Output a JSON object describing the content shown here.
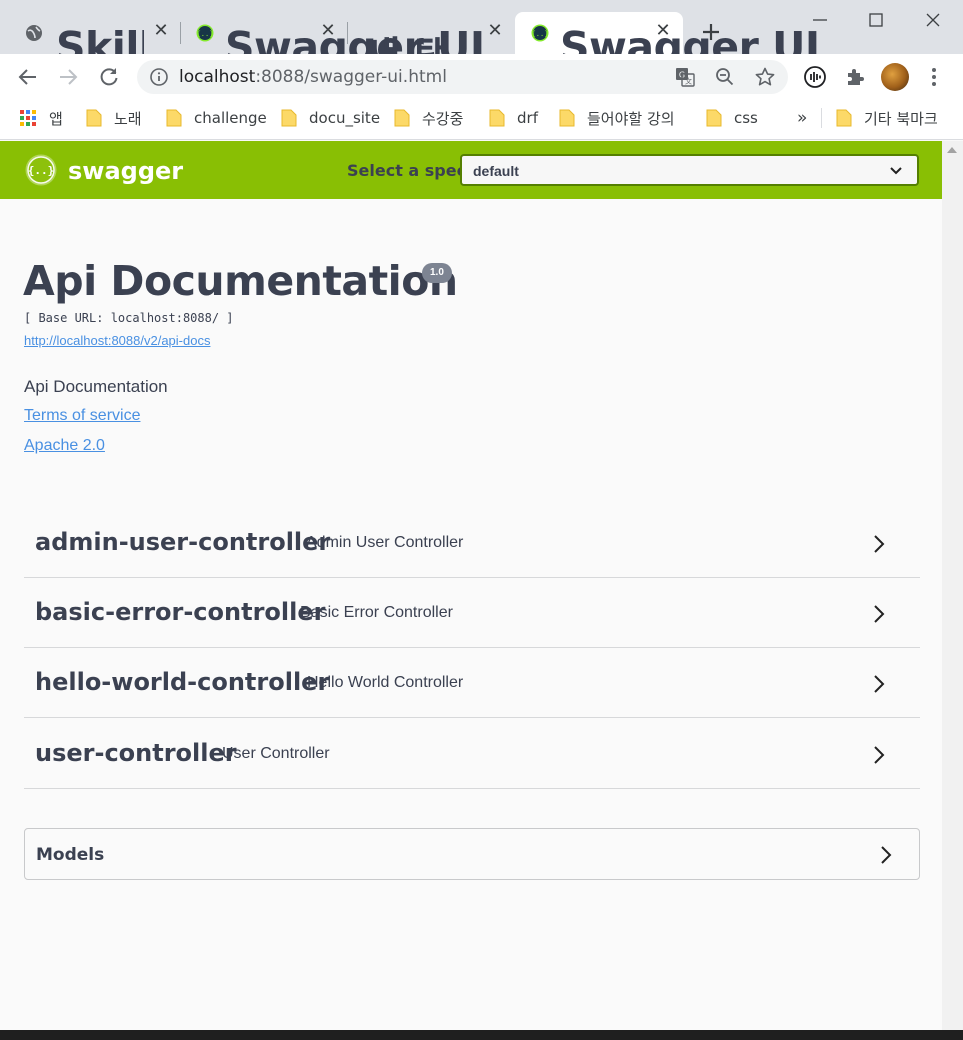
{
  "browser": {
    "tabs": [
      {
        "title": "Skill Note (in",
        "icon": "globe-icon"
      },
      {
        "title": "Swagger UI",
        "icon": "swagger-favicon"
      },
      {
        "title": "새 탭",
        "icon": ""
      },
      {
        "title": "Swagger UI",
        "icon": "swagger-favicon",
        "active": true
      }
    ],
    "url": {
      "host": "localhost",
      "rest": ":8088/swagger-ui.html"
    },
    "bookmarks": {
      "apps_label": "앱",
      "items": [
        "노래",
        "challenge",
        "docu_site",
        "수강중",
        "drf",
        "들어야할 강의",
        "css"
      ],
      "overflow": "»",
      "other": "기타 북마크"
    }
  },
  "swagger": {
    "logo_text": "swagger",
    "spec_label": "Select a spec",
    "spec_value": "default",
    "info": {
      "title": "Api Documentation",
      "version": "1.0",
      "base_url": "[ Base URL: localhost:8088/ ]",
      "api_docs_link": "http://localhost:8088/v2/api-docs",
      "description": "Api Documentation",
      "terms_link": "Terms of service",
      "license_link": "Apache 2.0"
    },
    "controllers": [
      {
        "name": "admin-user-controller",
        "description": "Admin User Controller"
      },
      {
        "name": "basic-error-controller",
        "description": "Basic Error Controller"
      },
      {
        "name": "hello-world-controller",
        "description": "Hello World Controller"
      },
      {
        "name": "user-controller",
        "description": "User Controller"
      }
    ],
    "models_label": "Models"
  },
  "colors": {
    "topbar": "#89bf04",
    "link": "#4990e2",
    "text": "#3b4151"
  }
}
